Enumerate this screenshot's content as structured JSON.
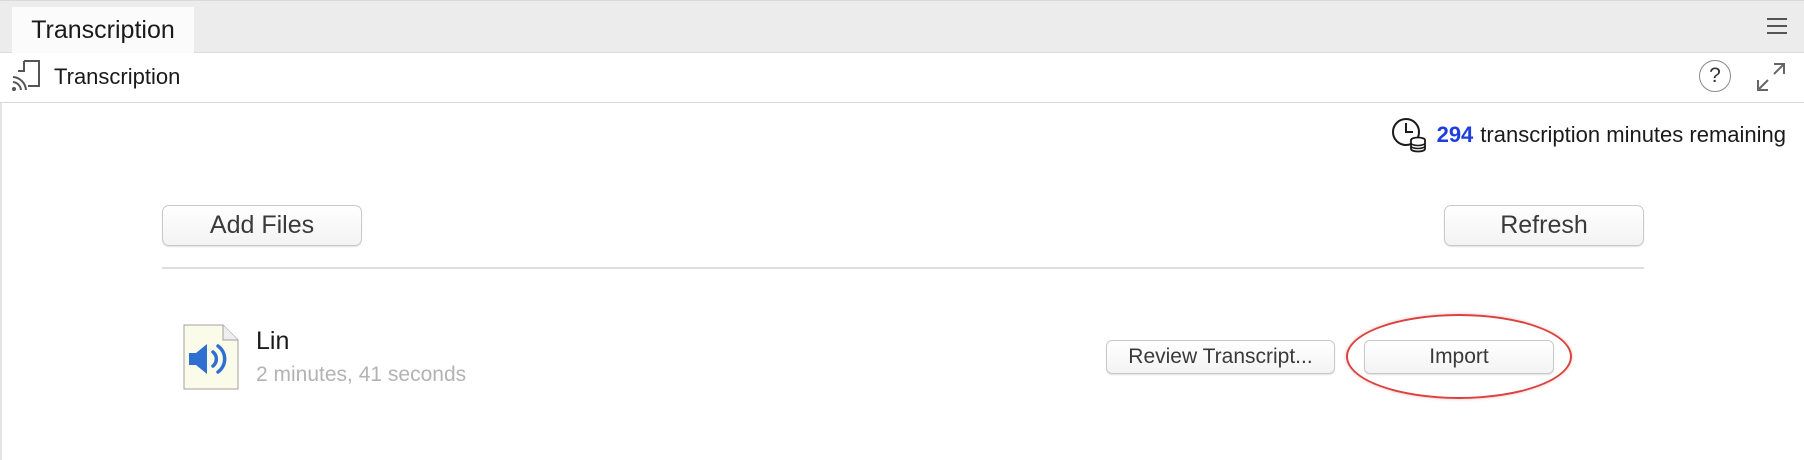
{
  "tab": {
    "label": "Transcription"
  },
  "icons": {
    "menu": "hamburger-menu-icon",
    "header": "transcription-cast-icon",
    "help": "help-icon",
    "expand": "expand-icon",
    "clock": "clock-coins-icon",
    "file": "audio-file-icon"
  },
  "header": {
    "title": "Transcription",
    "help_label": "?"
  },
  "minutes": {
    "count": "294",
    "text": "transcription minutes remaining",
    "count_color": "#1f3ee0"
  },
  "toolbar": {
    "add_label": "Add Files",
    "refresh_label": "Refresh"
  },
  "files": [
    {
      "name": "Lin",
      "duration": "2 minutes, 41 seconds",
      "review_label": "Review Transcript...",
      "import_label": "Import"
    }
  ],
  "colors": {
    "highlight": "#d9423f",
    "speaker": "#2f6fd1"
  }
}
